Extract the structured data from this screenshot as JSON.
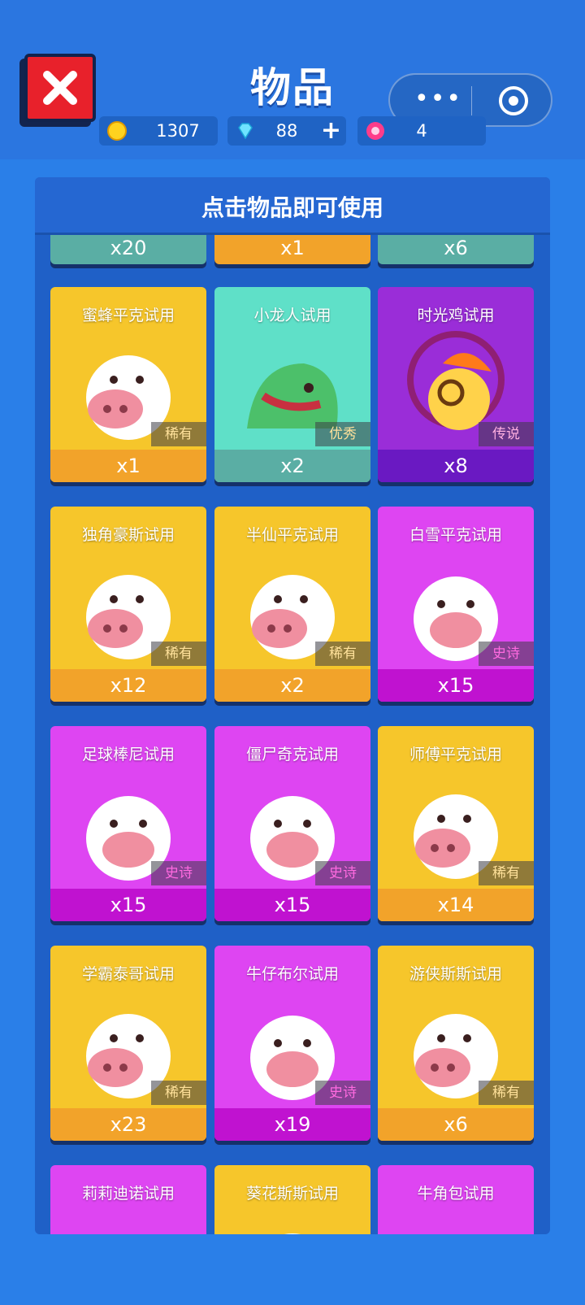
{
  "header": {
    "title": "物品",
    "close_icon": "close-x-icon",
    "capsule": {
      "more_icon": "more-dots-icon",
      "target_icon": "target-circle-icon"
    }
  },
  "currencies": {
    "coins": {
      "icon": "coin-icon",
      "value": "1307"
    },
    "gems": {
      "icon": "diamond-icon",
      "value": "88",
      "plus": "+"
    },
    "tickets": {
      "icon": "flower-token-icon",
      "value": "4"
    }
  },
  "panel": {
    "heading": "点击物品即可使用"
  },
  "top_partial": [
    {
      "count": "x20",
      "color": "#5aaea4"
    },
    {
      "count": "x1",
      "color": "#f2a32a"
    },
    {
      "count": "x6",
      "color": "#5aaea4"
    }
  ],
  "items": [
    {
      "name": "蜜蜂平克试用",
      "rarity": "稀有",
      "count": "x1",
      "theme": "yellow",
      "art": "bee-pig-icon"
    },
    {
      "name": "小龙人试用",
      "rarity": "优秀",
      "count": "x2",
      "theme": "teal",
      "art": "dragon-icon"
    },
    {
      "name": "时光鸡试用",
      "rarity": "传说",
      "count": "x8",
      "theme": "purple",
      "art": "time-chicken-icon"
    },
    {
      "name": "独角豪斯试用",
      "rarity": "稀有",
      "count": "x12",
      "theme": "yellow",
      "art": "unicorn-icon"
    },
    {
      "name": "半仙平克试用",
      "rarity": "稀有",
      "count": "x2",
      "theme": "yellow",
      "art": "fortune-pig-icon"
    },
    {
      "name": "白雪平克试用",
      "rarity": "史诗",
      "count": "x15",
      "theme": "pink",
      "art": "snow-white-pig-icon"
    },
    {
      "name": "足球棒尼试用",
      "rarity": "史诗",
      "count": "x15",
      "theme": "pink",
      "art": "bunny-icon"
    },
    {
      "name": "僵尸奇克试用",
      "rarity": "史诗",
      "count": "x15",
      "theme": "pink",
      "art": "zombie-icon"
    },
    {
      "name": "师傅平克试用",
      "rarity": "稀有",
      "count": "x14",
      "theme": "yellow",
      "art": "master-pig-icon"
    },
    {
      "name": "学霸泰哥试用",
      "rarity": "稀有",
      "count": "x23",
      "theme": "yellow",
      "art": "tiger-icon"
    },
    {
      "name": "牛仔布尔试用",
      "rarity": "史诗",
      "count": "x19",
      "theme": "pink",
      "art": "cowboy-bull-icon"
    },
    {
      "name": "游侠斯斯试用",
      "rarity": "稀有",
      "count": "x6",
      "theme": "yellow",
      "art": "ranger-icon"
    },
    {
      "name": "莉莉迪诺试用",
      "rarity": "",
      "count": "",
      "theme": "pink",
      "art": "dino-icon"
    },
    {
      "name": "葵花斯斯试用",
      "rarity": "",
      "count": "",
      "theme": "yellow",
      "art": "sunflower-icon"
    },
    {
      "name": "牛角包试用",
      "rarity": "",
      "count": "",
      "theme": "pink",
      "art": "croissant-icon"
    }
  ]
}
